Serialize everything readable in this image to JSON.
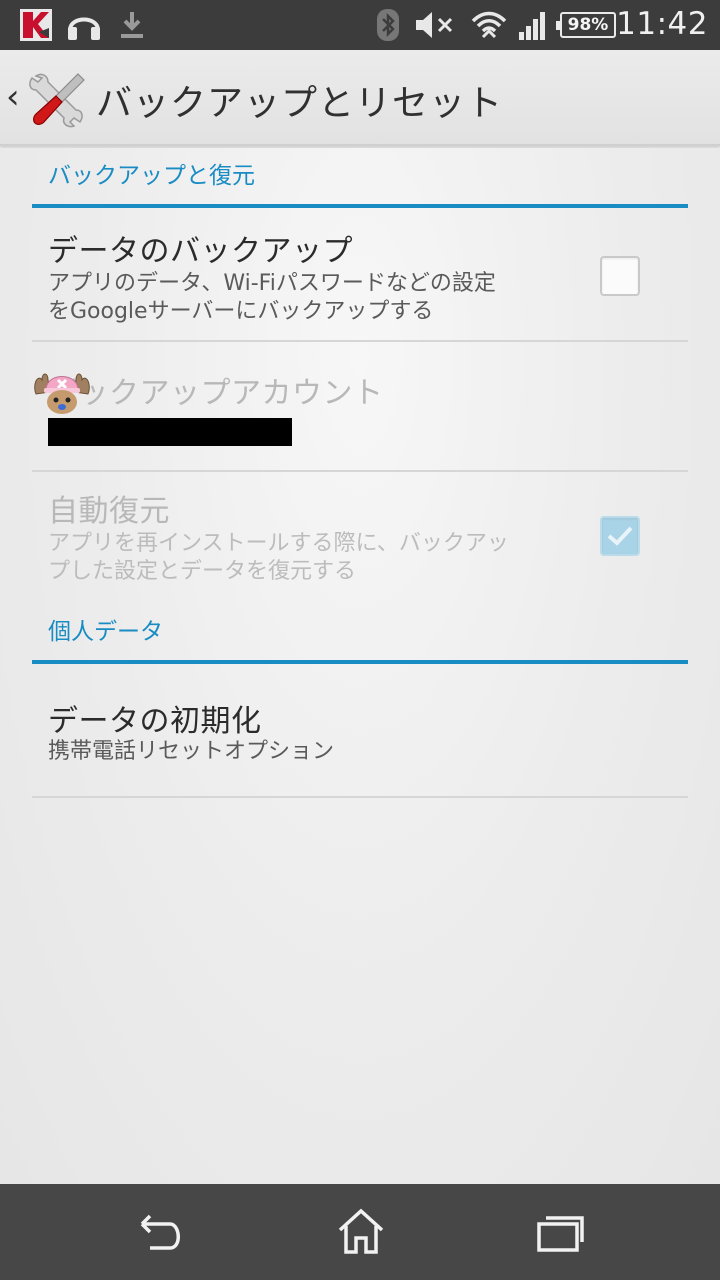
{
  "status_bar": {
    "time": "11:42",
    "battery_percent": "98%",
    "icons": [
      "kaspersky-icon",
      "headphones-icon",
      "download-icon",
      "bluetooth-icon",
      "mute-icon",
      "wifi-icon",
      "signal-icon",
      "battery-icon"
    ]
  },
  "action_bar": {
    "title": "バックアップとリセット"
  },
  "sections": {
    "backup": {
      "header": "バックアップと復元",
      "data_backup": {
        "title": "データのバックアップ",
        "summary_line1": "アプリのデータ、Wi-Fiパスワードなどの設定",
        "summary_line2": "をGoogleサーバーにバックアップする",
        "checked": false
      },
      "backup_account": {
        "title": "バックアップアカウント"
      },
      "auto_restore": {
        "title": "自動復元",
        "summary_line1": "アプリを再インストールする際に、バックアッ",
        "summary_line2": "プした設定とデータを復元する",
        "checked": true
      }
    },
    "personal": {
      "header": "個人データ",
      "factory_reset": {
        "title": "データの初期化",
        "summary": "携帯電話リセットオプション"
      }
    }
  },
  "nav_bar": {
    "buttons": [
      "back-icon",
      "home-icon",
      "recent-apps-icon"
    ]
  },
  "colors": {
    "accent": "#1a8cc4",
    "status_bar": "#3c3c3c",
    "nav_bar": "#474747"
  }
}
